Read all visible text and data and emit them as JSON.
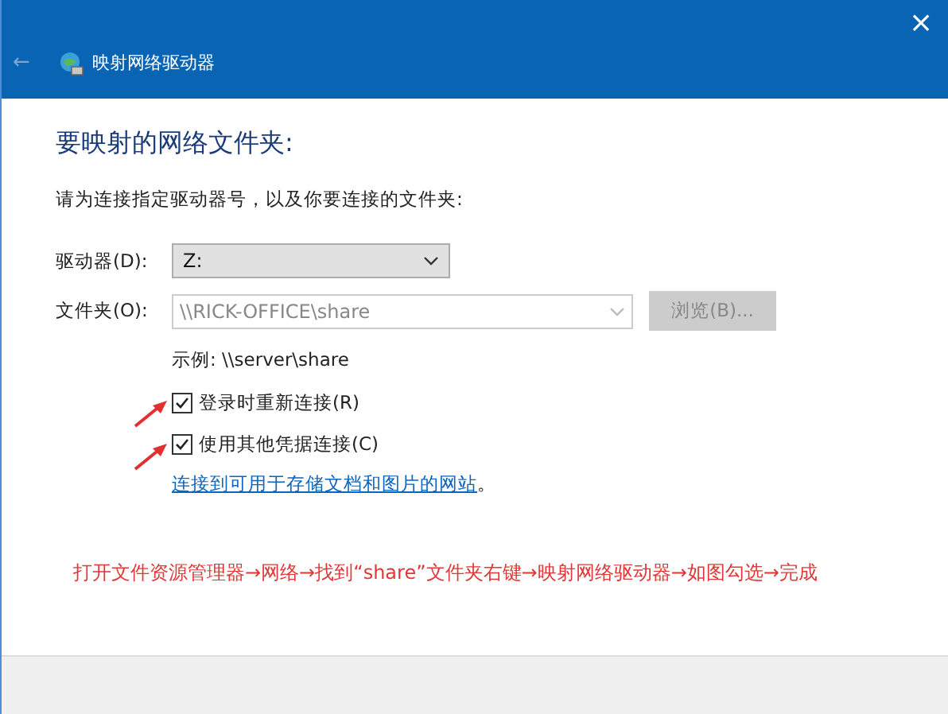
{
  "window": {
    "title": "映射网络驱动器",
    "close": "×",
    "back": "←"
  },
  "heading": "要映射的网络文件夹:",
  "instruction": "请为连接指定驱动器号，以及你要连接的文件夹:",
  "drive": {
    "label": "驱动器(D):",
    "value": "Z:"
  },
  "folder": {
    "label": "文件夹(O):",
    "value": "\\\\RICK-OFFICE\\share",
    "disabled": true,
    "browse": "浏览(B)..."
  },
  "example": "示例: \\\\server\\share",
  "options": [
    {
      "label": "登录时重新连接(R)",
      "checked": true
    },
    {
      "label": "使用其他凭据连接(C)",
      "checked": true
    }
  ],
  "link": "连接到可用于存储文档和图片的网站",
  "link_suffix": "。",
  "annotation": "打开文件资源管理器→网络→找到“share”文件夹右键→映射网络驱动器→如图勾选→完成"
}
